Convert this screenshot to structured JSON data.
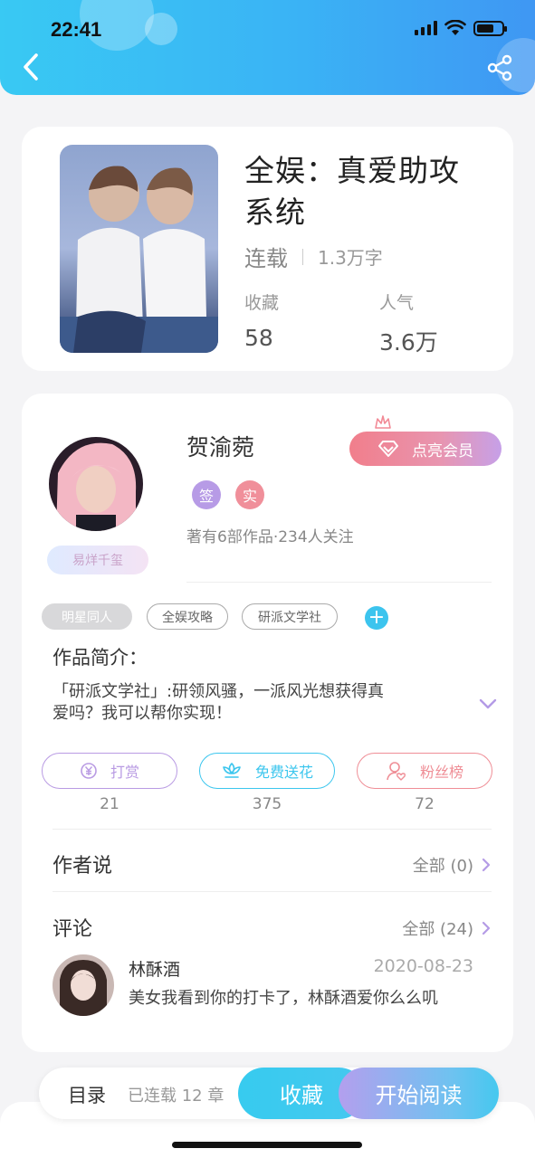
{
  "status_bar": {
    "time": "22:41"
  },
  "book": {
    "title": "全娱：真爱助攻系统",
    "status": "连载",
    "word_count": "1.3万字",
    "stats": [
      {
        "label": "收藏",
        "value": "58"
      },
      {
        "label": "人气",
        "value": "3.6万"
      }
    ]
  },
  "author": {
    "name": "贺渝菀",
    "badge": "易烊千玺",
    "tags": [
      {
        "text": "签",
        "color": "#b79be6"
      },
      {
        "text": "实",
        "color": "#f08f9a"
      }
    ],
    "works_info": "著有6部作品·234人关注",
    "vip_button": "点亮会员"
  },
  "chips": [
    "明星同人",
    "全娱攻略",
    "研派文学社"
  ],
  "synopsis": {
    "title": "作品简介：",
    "text": "「研派文学社」:研领风骚，一派风光想获得真爱吗？我可以帮你实现！"
  },
  "actions": [
    {
      "label": "打赏",
      "count": "21",
      "color": "#b99be3"
    },
    {
      "label": "免费送花",
      "count": "375",
      "color": "#3cc6ee"
    },
    {
      "label": "粉丝榜",
      "count": "72",
      "color": "#ef8e96"
    }
  ],
  "author_says": {
    "title": "作者说",
    "link": "全部 (0)"
  },
  "comments": {
    "title": "评论",
    "link": "全部 (24)",
    "items": [
      {
        "user": "林酥酒",
        "date": "2020-08-23",
        "text": "美女我看到你的打卡了，林酥酒爱你么么叽"
      }
    ]
  },
  "bottom_bar": {
    "toc": "目录",
    "serial_count": "已连载 12 章",
    "favorite": "收藏",
    "start_reading": "开始阅读"
  },
  "colors": {
    "accent": "#3cc6ee",
    "purple": "#b79be6",
    "pink": "#f08f9a"
  }
}
